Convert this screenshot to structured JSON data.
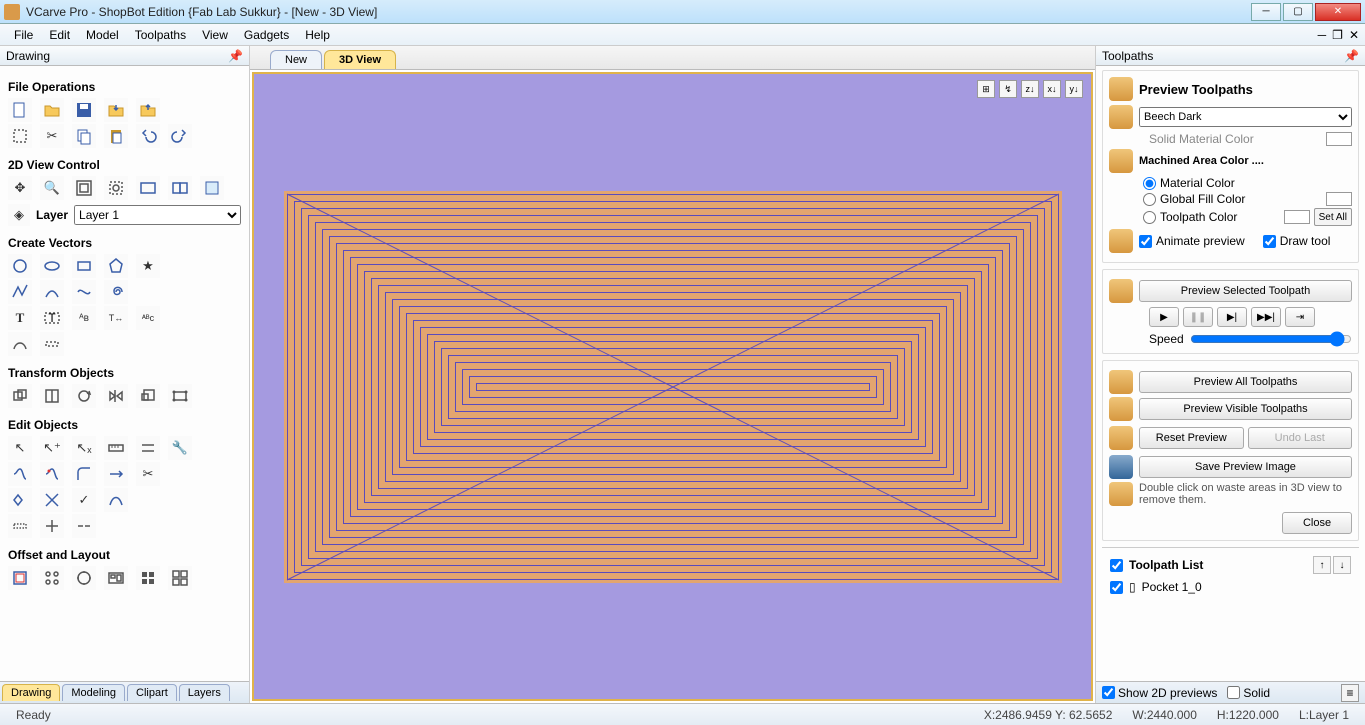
{
  "window": {
    "title": "VCarve Pro - ShopBot Edition {Fab Lab Sukkur} - [New - 3D View]"
  },
  "menus": [
    "File",
    "Edit",
    "Model",
    "Toolpaths",
    "View",
    "Gadgets",
    "Help"
  ],
  "left_panel": {
    "title": "Drawing",
    "sections": {
      "file_ops": "File Operations",
      "view_control": "2D View Control",
      "layer_label": "Layer",
      "layer_value": "Layer 1",
      "create_vectors": "Create Vectors",
      "transform": "Transform Objects",
      "edit": "Edit Objects",
      "offset": "Offset and Layout"
    },
    "bottom_tabs": [
      "Drawing",
      "Modeling",
      "Clipart",
      "Layers"
    ],
    "active_bottom_tab": 0
  },
  "center": {
    "tabs": [
      "New",
      "3D View"
    ],
    "active_tab": 1,
    "vp_tool_labels": [
      "⊞",
      "↯",
      "z↓",
      "x↓",
      "y↓"
    ]
  },
  "right_panel": {
    "title": "Toolpaths",
    "preview_title": "Preview Toolpaths",
    "material": {
      "selected": "Beech Dark",
      "solid_label": "Solid Material Color"
    },
    "machined_area": {
      "title": "Machined Area Color ....",
      "opt_material": "Material Color",
      "opt_global": "Global Fill Color",
      "opt_toolpath": "Toolpath Color",
      "setall": "Set All"
    },
    "checks": {
      "animate": "Animate preview",
      "drawtool": "Draw tool"
    },
    "buttons": {
      "preview_selected": "Preview Selected Toolpath",
      "preview_all": "Preview All Toolpaths",
      "preview_visible": "Preview Visible Toolpaths",
      "reset": "Reset Preview",
      "undo": "Undo Last",
      "save_image": "Save Preview Image",
      "close": "Close"
    },
    "speed_label": "Speed",
    "hint": "Double click on waste areas in 3D view to remove them.",
    "toolpath_list": {
      "header": "Toolpath List",
      "items": [
        "Pocket 1_0"
      ]
    },
    "bottom": {
      "show2d": "Show 2D previews",
      "solid": "Solid"
    }
  },
  "status": {
    "ready": "Ready",
    "xy": "X:2486.9459 Y: 62.5652",
    "w": "W:2440.000",
    "h": "H:1220.000",
    "layer": "L:Layer 1"
  }
}
